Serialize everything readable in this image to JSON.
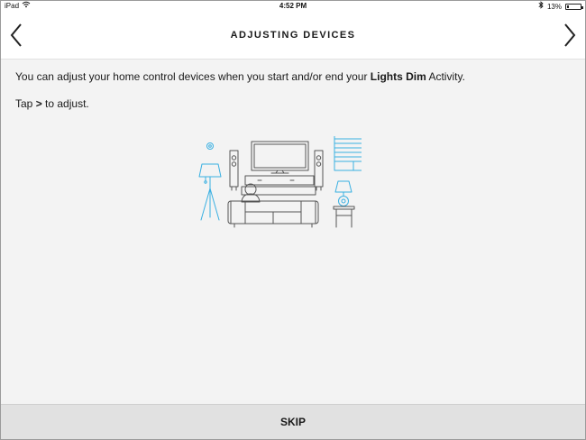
{
  "status_bar": {
    "carrier": "iPad",
    "wifi_icon": "wifi-icon",
    "time": "4:52 PM",
    "bluetooth_icon": "bluetooth-icon",
    "battery_percent": "13%",
    "battery_level": 0.13
  },
  "nav": {
    "title": "ADJUSTING DEVICES",
    "back_icon": "chevron-left-icon",
    "forward_icon": "chevron-right-icon"
  },
  "content": {
    "line1_pre": "You can adjust your home control devices when you start and/or end your ",
    "line1_bold": "Lights Dim",
    "line1_post": " Activity.",
    "line2_pre": "Tap ",
    "line2_bold": ">",
    "line2_post": " to adjust."
  },
  "illustration": {
    "name": "living-room-illustration",
    "accent_color": "#3ab0e2",
    "line_color": "#555555"
  },
  "footer": {
    "skip_label": "SKIP"
  }
}
